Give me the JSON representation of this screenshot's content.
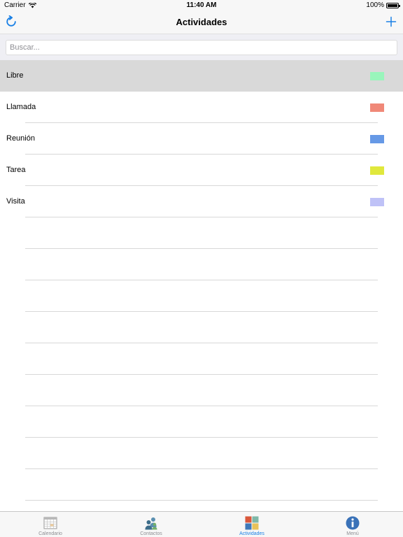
{
  "status_bar": {
    "carrier": "Carrier",
    "time": "11:40 AM",
    "battery": "100%"
  },
  "nav": {
    "title": "Actividades",
    "left_icon": "refresh-icon",
    "right_icon": "plus-icon",
    "accent_color": "#1a80e5"
  },
  "search": {
    "placeholder": "Buscar...",
    "value": ""
  },
  "activities": [
    {
      "label": "Libre",
      "color": "#99f5bb",
      "selected": true
    },
    {
      "label": "Llamada",
      "color": "#f08878",
      "selected": false
    },
    {
      "label": "Reunión",
      "color": "#6699e6",
      "selected": false
    },
    {
      "label": "Tarea",
      "color": "#e0e83c",
      "selected": false
    },
    {
      "label": "Visita",
      "color": "#bfc2f7",
      "selected": false
    }
  ],
  "tabs": [
    {
      "label": "Calendario",
      "icon": "calendar-icon",
      "active": false
    },
    {
      "label": "Contactos",
      "icon": "contacts-icon",
      "active": false
    },
    {
      "label": "Actividades",
      "icon": "activities-icon",
      "active": true
    },
    {
      "label": "Menú",
      "icon": "info-icon",
      "active": false
    }
  ]
}
